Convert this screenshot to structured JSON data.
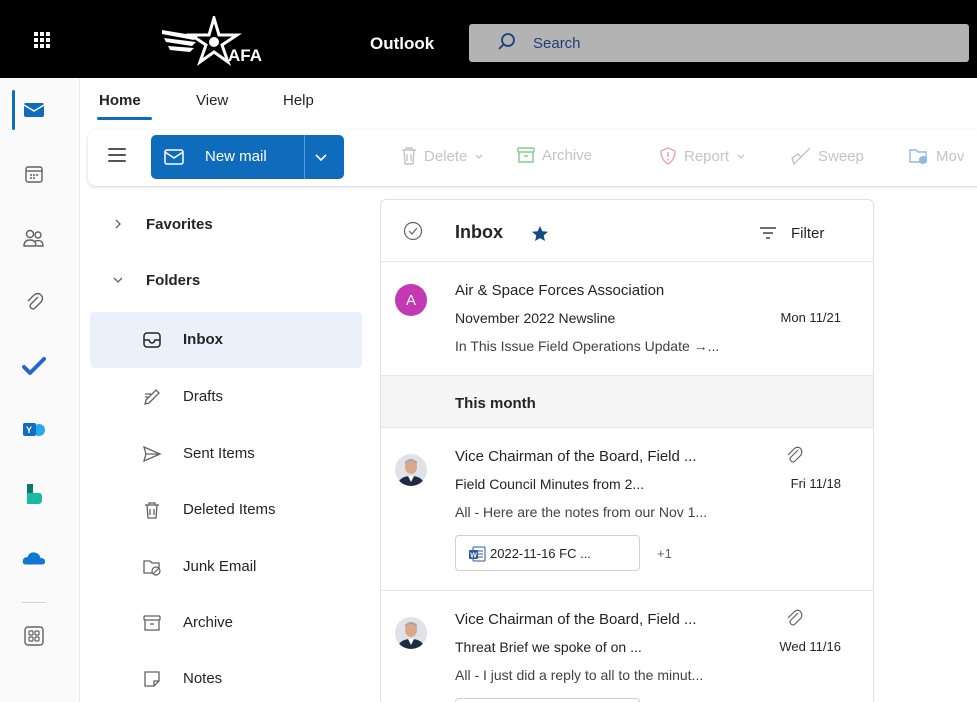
{
  "header": {
    "launcher_icon": "app-launcher-grid-icon",
    "logo_text": "AFA",
    "app_name": "Outlook",
    "search_placeholder": "Search"
  },
  "rail": {
    "items": [
      "mail-icon",
      "calendar-icon",
      "people-icon",
      "attachment-icon",
      "todo-check-icon",
      "yammer-icon",
      "bookings-icon",
      "onedrive-icon",
      "more-apps-icon"
    ],
    "active": "mail-icon"
  },
  "ribbon": {
    "tabs": [
      {
        "label": "Home",
        "active": true
      },
      {
        "label": "View",
        "active": false
      },
      {
        "label": "Help",
        "active": false
      }
    ],
    "new_mail_label": "New mail",
    "actions": [
      {
        "label": "Delete",
        "icon": "trash-icon",
        "dropdown": true
      },
      {
        "label": "Archive",
        "icon": "archive-icon",
        "dropdown": false
      },
      {
        "label": "Report",
        "icon": "shield-warning-icon",
        "dropdown": true
      },
      {
        "label": "Sweep",
        "icon": "broom-icon",
        "dropdown": false
      },
      {
        "label": "Mov",
        "icon": "move-folder-icon",
        "dropdown": false
      }
    ]
  },
  "folders": {
    "favorites_label": "Favorites",
    "folders_label": "Folders",
    "items": [
      {
        "label": "Inbox",
        "icon": "inbox-icon",
        "selected": true
      },
      {
        "label": "Drafts",
        "icon": "pencil-icon",
        "selected": false
      },
      {
        "label": "Sent Items",
        "icon": "send-icon",
        "selected": false
      },
      {
        "label": "Deleted Items",
        "icon": "trash-icon",
        "selected": false
      },
      {
        "label": "Junk Email",
        "icon": "junk-folder-icon",
        "selected": false
      },
      {
        "label": "Archive",
        "icon": "archive-icon",
        "selected": false
      },
      {
        "label": "Notes",
        "icon": "note-icon",
        "selected": false
      }
    ]
  },
  "message_list": {
    "title": "Inbox",
    "filter_label": "Filter",
    "group_label": "This month",
    "messages": [
      {
        "avatar_letter": "A",
        "sender": "Air & Space Forces Association",
        "subject": "November 2022 Newsline",
        "date": "Mon 11/21",
        "preview": "In This Issue Field Operations Update →..."
      },
      {
        "sender": "Vice Chairman of the Board, Field ...",
        "subject": "Field Council Minutes from 2...",
        "date": "Fri 11/18",
        "preview": "All - Here are the notes from our Nov 1...",
        "attachment": "2022-11-16 FC ...",
        "more_attachments": "+1"
      },
      {
        "sender": "Vice Chairman of the Board, Field ...",
        "subject": "Threat Brief we spoke of on ...",
        "date": "Wed 11/16",
        "preview": "All - I just did a reply to all to the minut..."
      }
    ]
  },
  "colors": {
    "accent": "#0f6cbd",
    "avatar_a": "#c239b3",
    "topbar": "#000000",
    "search_bg": "#b3b3b3",
    "selected_folder": "#eaf1fb"
  }
}
